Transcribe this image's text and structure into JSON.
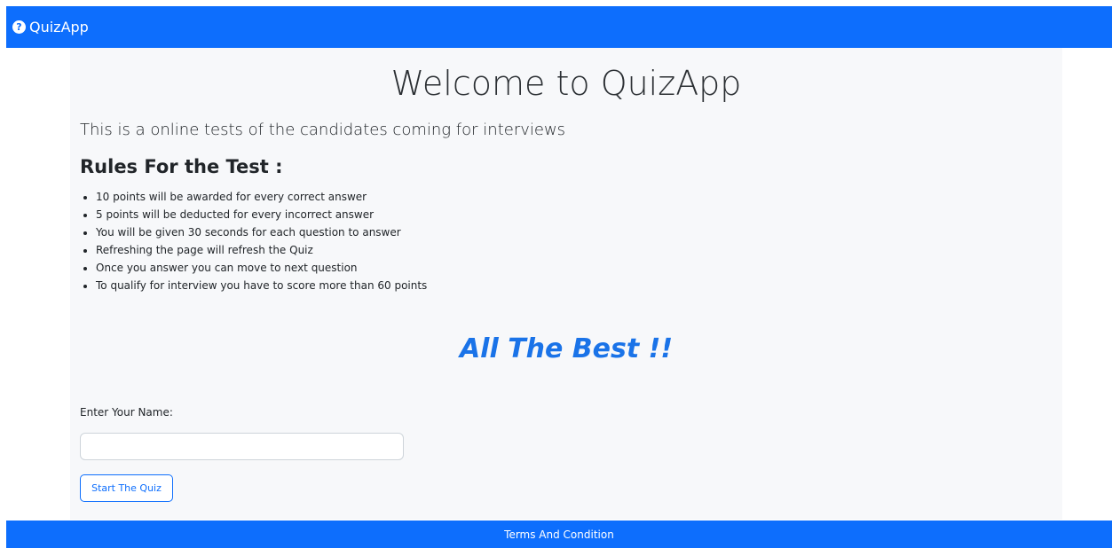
{
  "navbar": {
    "brand_icon": "?",
    "brand_label": "QuizApp"
  },
  "main": {
    "title": "Welcome to QuizApp",
    "lead": "This is a online tests of the candidates coming for interviews",
    "rules_heading": "Rules For the Test :",
    "rules": [
      "10 points will be awarded for every correct answer",
      "5 points will be deducted for every incorrect answer",
      "You will be given 30 seconds for each question to answer",
      "Refreshing the page will refresh the Quiz",
      "Once you answer you can move to next question",
      "To qualify for interview you have to score more than 60 points"
    ],
    "best_wishes": "All The Best !!",
    "name_label": "Enter Your Name:",
    "name_value": "",
    "name_placeholder": "",
    "start_button": "Start The Quiz"
  },
  "footer": {
    "link": "Terms And Condition"
  },
  "colors": {
    "primary": "#0d6efd",
    "jumbotron_bg": "#f7f8fa",
    "best_text": "#1a73e8"
  },
  "icons": {
    "brand": "question-circle-icon"
  }
}
